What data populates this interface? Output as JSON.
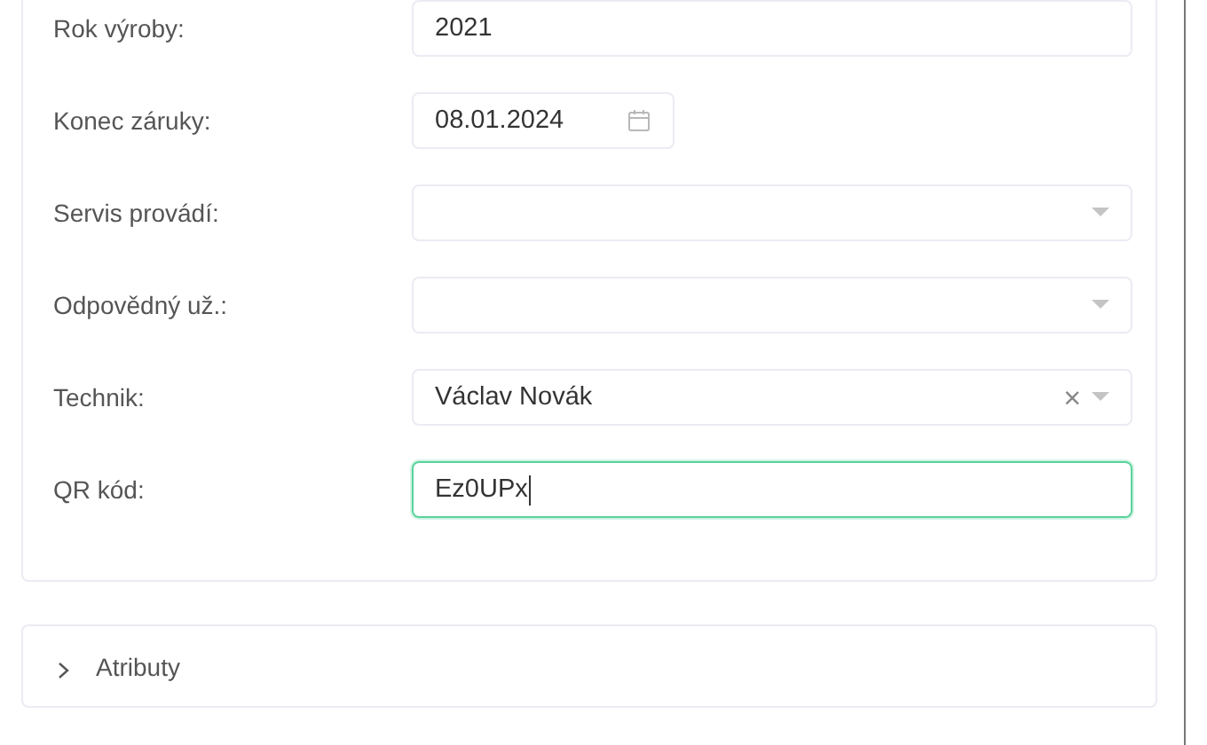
{
  "form": {
    "fields": [
      {
        "label": "Rok výroby:",
        "kind": "text",
        "value": "2021",
        "focused": false
      },
      {
        "label": "Konec záruky:",
        "kind": "date",
        "value": "08.01.2024",
        "focused": false
      },
      {
        "label": "Servis provádí:",
        "kind": "select",
        "focused": false
      },
      {
        "label": "Odpovědný už.:",
        "kind": "select",
        "focused": false
      },
      {
        "label": "Technik:",
        "kind": "select",
        "value": "Václav Novák",
        "clear": "×",
        "focused": false
      },
      {
        "label": "QR kód:",
        "kind": "text",
        "value": "Ez0UPx",
        "focused": true
      }
    ]
  },
  "section": {
    "title": "Atributy",
    "expanded": false
  }
}
